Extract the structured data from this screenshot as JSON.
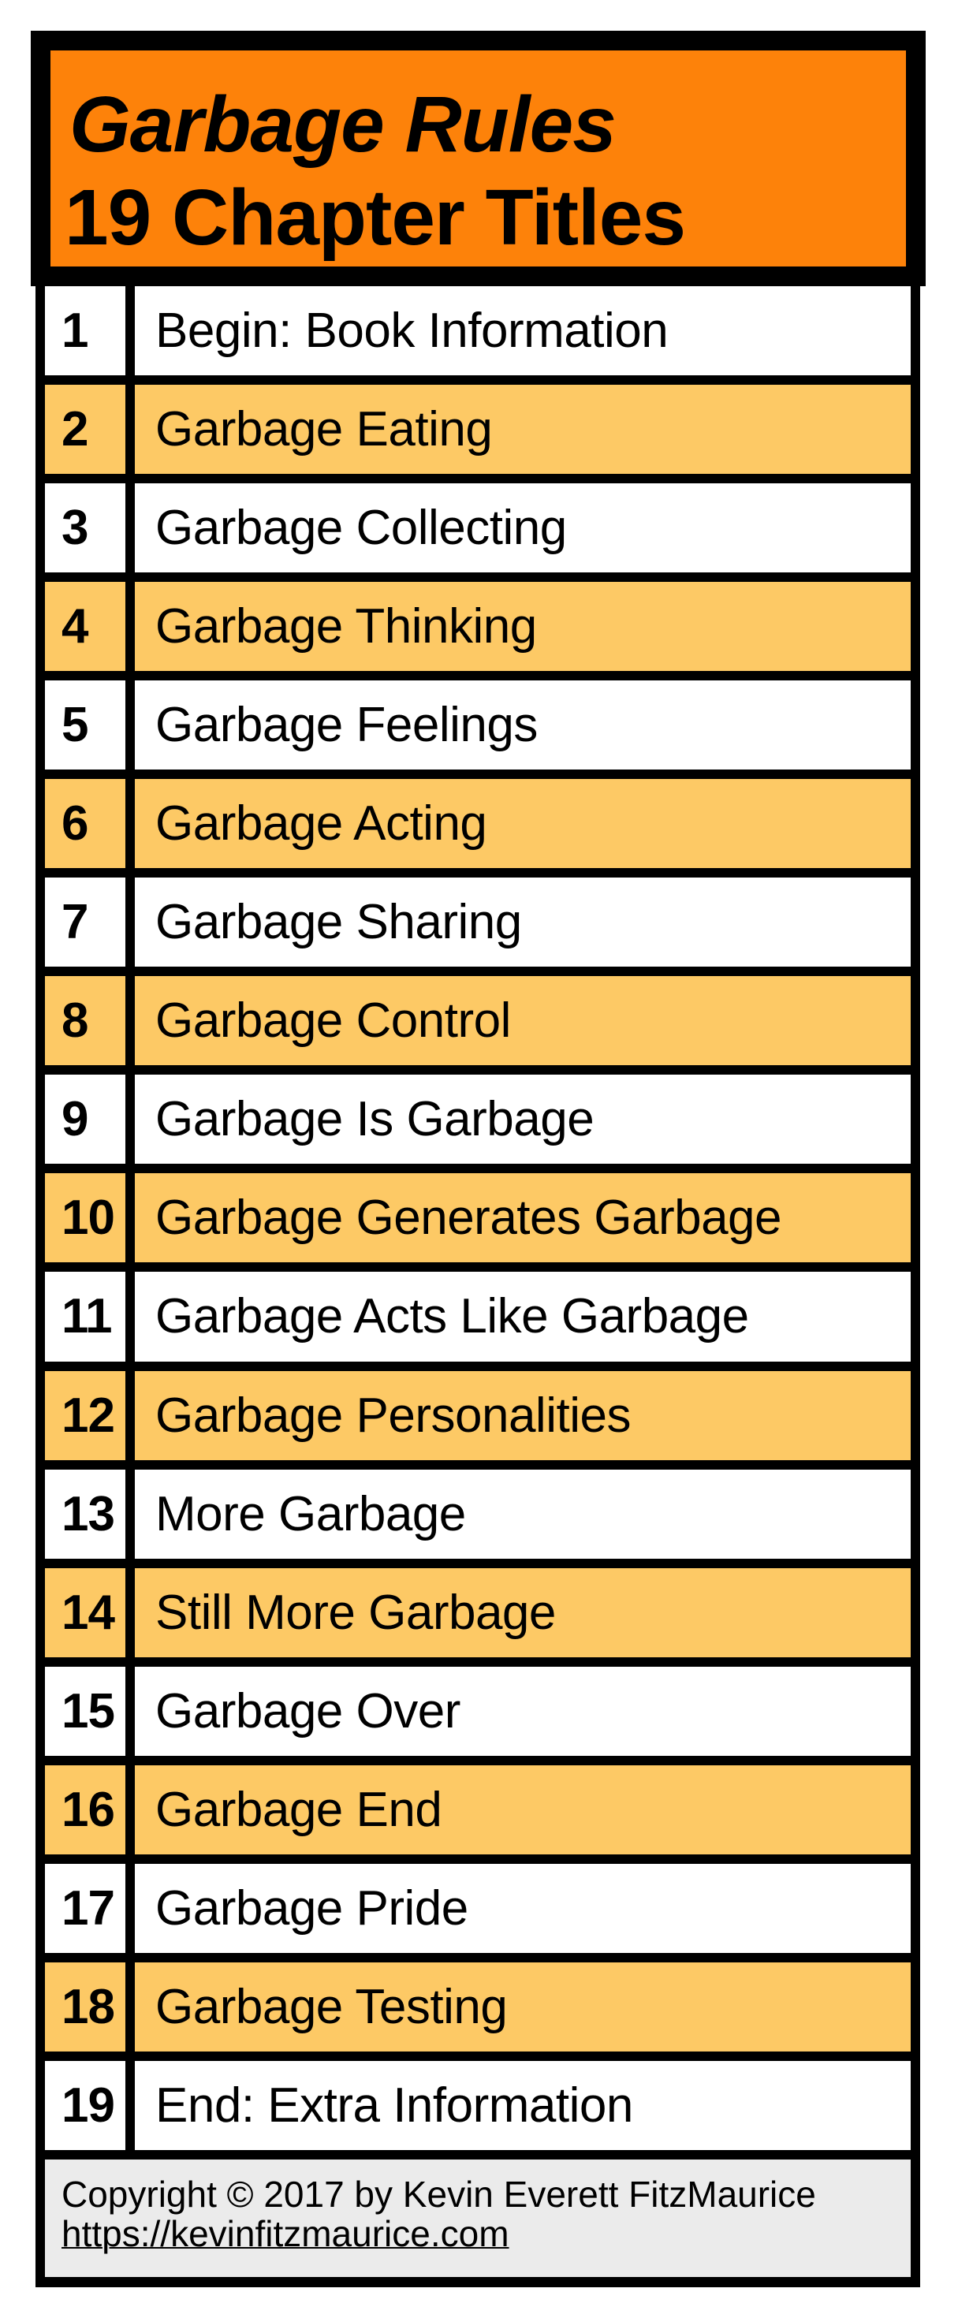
{
  "colors": {
    "header_bg": "#fd820a",
    "alt_row_bg": "#fdc965",
    "row_bg": "#ffffff",
    "footer_bg": "#ebebeb",
    "border": "#000000"
  },
  "header": {
    "title": "Garbage Rules",
    "subtitle": "19 Chapter Titles"
  },
  "chapters": [
    {
      "number": "1",
      "title": "Begin: Book Information"
    },
    {
      "number": "2",
      "title": "Garbage Eating"
    },
    {
      "number": "3",
      "title": "Garbage Collecting"
    },
    {
      "number": "4",
      "title": "Garbage Thinking"
    },
    {
      "number": "5",
      "title": "Garbage Feelings"
    },
    {
      "number": "6",
      "title": "Garbage Acting"
    },
    {
      "number": "7",
      "title": "Garbage Sharing"
    },
    {
      "number": "8",
      "title": "Garbage Control"
    },
    {
      "number": "9",
      "title": "Garbage Is Garbage"
    },
    {
      "number": "10",
      "title": "Garbage Generates Garbage"
    },
    {
      "number": "11",
      "title": "Garbage Acts Like Garbage"
    },
    {
      "number": "12",
      "title": "Garbage Personalities"
    },
    {
      "number": "13",
      "title": "More Garbage"
    },
    {
      "number": "14",
      "title": "Still More Garbage"
    },
    {
      "number": "15",
      "title": "Garbage Over"
    },
    {
      "number": "16",
      "title": "Garbage End"
    },
    {
      "number": "17",
      "title": "Garbage Pride"
    },
    {
      "number": "18",
      "title": "Garbage Testing"
    },
    {
      "number": "19",
      "title": "End: Extra Information"
    }
  ],
  "footer": {
    "copyright": "Copyright © 2017 by Kevin Everett FitzMaurice",
    "link": "https://kevinfitzmaurice.com"
  }
}
